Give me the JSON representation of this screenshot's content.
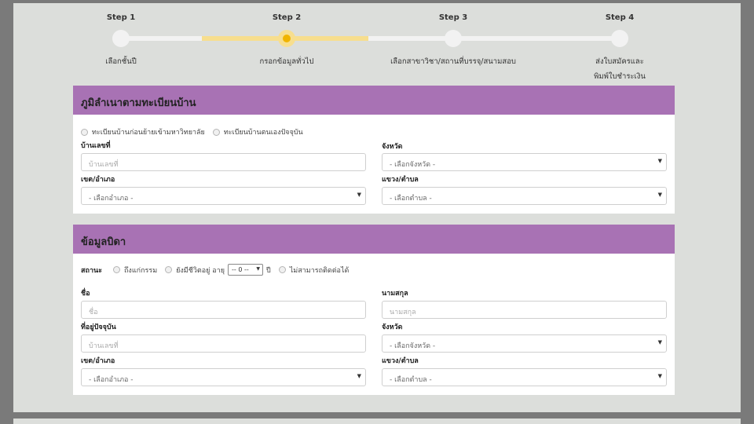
{
  "stepper": {
    "steps": [
      {
        "title": "Step 1",
        "label": "เลือกชั้นปี",
        "label2": ""
      },
      {
        "title": "Step 2",
        "label": "กรอกข้อมูลทั่วไป",
        "label2": ""
      },
      {
        "title": "Step 3",
        "label": "เลือกสาขาวิชา/สถานที่บรรจุ/สนามสอบ",
        "label2": ""
      },
      {
        "title": "Step 4",
        "label": "ส่งใบสมัครและ",
        "label2": "พิมพ์ใบชำระเงิน"
      }
    ],
    "current_step": 2
  },
  "house_registration": {
    "title": "ภูมิลำเนาตามทะเบียนบ้าน",
    "radio_1": "ทะเบียนบ้านก่อนย้ายเข้ามหาวิทยาลัย",
    "radio_2": "ทะเบียนบ้านตนเองปัจจุบัน",
    "house_no_label": "บ้านเลขที่",
    "house_no_placeholder": "บ้านเลขที่",
    "province_label": "จังหวัด",
    "province_value": "- เลือกจังหวัด -",
    "district_label": "เขต/อำเภอ",
    "district_value": "- เลือกอำเภอ -",
    "subdistrict_label": "แขวง/ตำบล",
    "subdistrict_value": "- เลือกตำบล -"
  },
  "father_info": {
    "title": "ข้อมูลบิดา",
    "status_label": "สถานะ",
    "status_deceased": "ถึงแก่กรรม",
    "status_alive": "ยังมีชีวิตอยู่ อายุ",
    "age_value": "-- 0 --",
    "age_unit": "ปี",
    "status_unreachable": "ไม่สามารถติดต่อได้",
    "first_name_label": "ชื่อ",
    "first_name_placeholder": "ชื่อ",
    "last_name_label": "นามสกุล",
    "last_name_placeholder": "นามสกุล",
    "address_label": "ที่อยู่ปัจจุบัน",
    "address_placeholder": "บ้านเลขที่",
    "province_label": "จังหวัด",
    "province_value": "- เลือกจังหวัด -",
    "district_label": "เขต/อำเภอ",
    "district_value": "- เลือกอำเภอ -",
    "subdistrict_label": "แขวง/ตำบล",
    "subdistrict_value": "- เลือกตำบล -"
  },
  "colors": {
    "panel_header": "#a872b4",
    "step_active": "#f7de8e",
    "step_current_dot": "#f0b400"
  },
  "icons": {
    "select_caret": "▼"
  }
}
